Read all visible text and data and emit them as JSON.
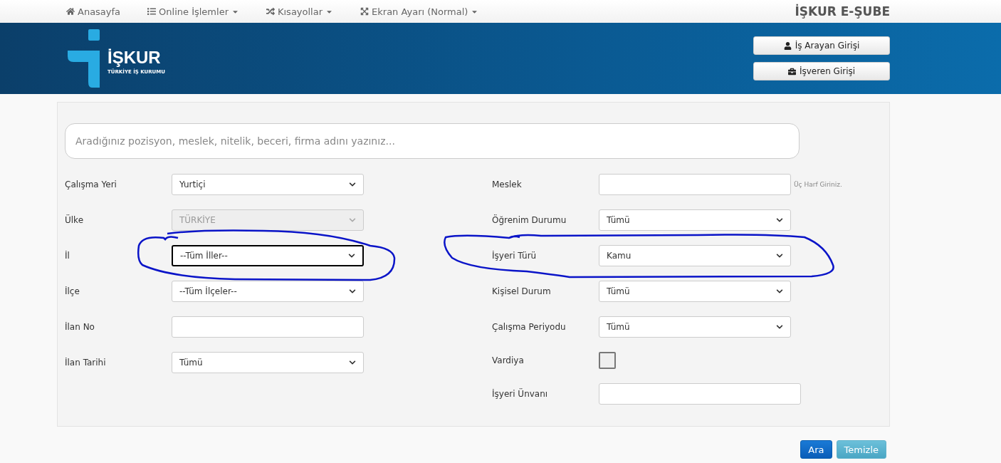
{
  "nav": {
    "items": [
      {
        "label": "Anasayfa",
        "dropdown": false
      },
      {
        "label": "Online İşlemler",
        "dropdown": true
      },
      {
        "label": "Kısayollar",
        "dropdown": true
      },
      {
        "label": "Ekran Ayarı (Normal)",
        "dropdown": true
      }
    ],
    "title": "İŞKUR E-ŞUBE"
  },
  "banner": {
    "logo": {
      "name": "İŞKUR",
      "subtitle": "TÜRKİYE İŞ KURUMU"
    },
    "buttons": [
      "İş Arayan Girişi",
      "İşveren Girişi"
    ]
  },
  "search": {
    "placeholder": "Aradığınız pozisyon, meslek, nitelik, beceri, firma adını yazınız..."
  },
  "left_fields": [
    {
      "label": "Çalışma Yeri",
      "kind": "select",
      "value": "Yurtiçi",
      "disabled": false,
      "focused": false
    },
    {
      "label": "Ülke",
      "kind": "select",
      "value": "TÜRKİYE",
      "disabled": true,
      "focused": false
    },
    {
      "label": "İl",
      "kind": "select",
      "value": "--Tüm İller--",
      "disabled": false,
      "focused": true
    },
    {
      "label": "İlçe",
      "kind": "select",
      "value": "--Tüm İlçeler--",
      "disabled": false,
      "focused": false
    },
    {
      "label": "İlan No",
      "kind": "input"
    },
    {
      "label": "İlan Tarihi",
      "kind": "select",
      "value": "Tümü",
      "disabled": false,
      "focused": false
    }
  ],
  "right_fields": [
    {
      "label": "Meslek",
      "kind": "input",
      "hint": "Üç Harf Giriniz."
    },
    {
      "label": "Öğrenim Durumu",
      "kind": "select",
      "value": "Tümü",
      "disabled": false,
      "focused": false
    },
    {
      "label": "İşyeri Türü",
      "kind": "select",
      "value": "Kamu",
      "disabled": false,
      "focused": false
    },
    {
      "label": "Kişisel Durum",
      "kind": "select",
      "value": "Tümü",
      "disabled": false,
      "focused": false
    },
    {
      "label": "Çalışma Periyodu",
      "kind": "select",
      "value": "Tümü",
      "disabled": false,
      "focused": false
    },
    {
      "label": "Vardiya",
      "kind": "checkbox",
      "checked": false
    },
    {
      "label": "İşyeri Ünvanı",
      "kind": "input",
      "wide": true
    }
  ],
  "actions": [
    {
      "label": "Ara",
      "kind": "primary"
    },
    {
      "label": "Temizle",
      "kind": "info"
    }
  ]
}
